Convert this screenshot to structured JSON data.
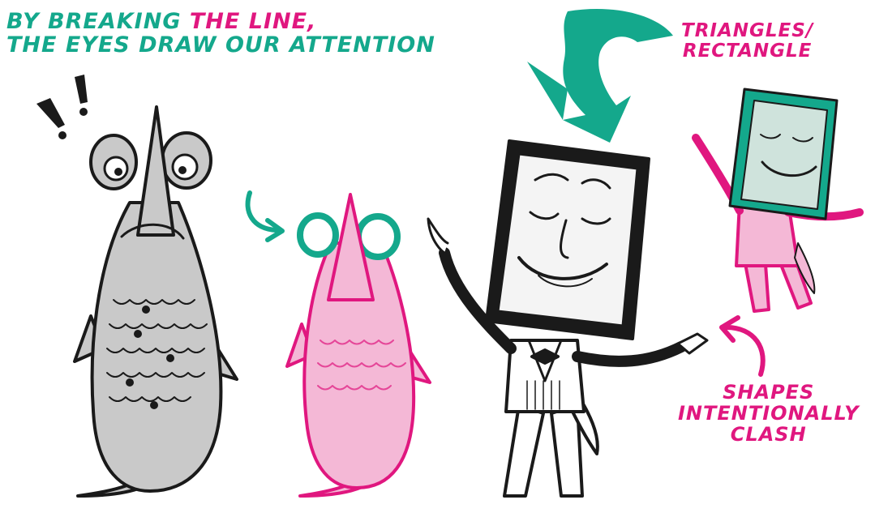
{
  "headline": {
    "line1_part1": "BY BREAKING ",
    "line1_part2": "THE LINE,",
    "line2": "THE EYES DRAW OUR ATTENTION"
  },
  "labels": {
    "triangles_line1": "TRIANGLES/",
    "triangles_line2": "RECTANGLE",
    "clash_line1": "SHAPES",
    "clash_line2": "INTENTIONALLY",
    "clash_line3": "CLASH"
  },
  "colors": {
    "teal": "#14a88c",
    "pink": "#e0177f",
    "ink": "#1a1a1a",
    "gray": "#c9c9c9",
    "pink_fill": "#f4b8d6",
    "screen": "#cfe3dc"
  }
}
